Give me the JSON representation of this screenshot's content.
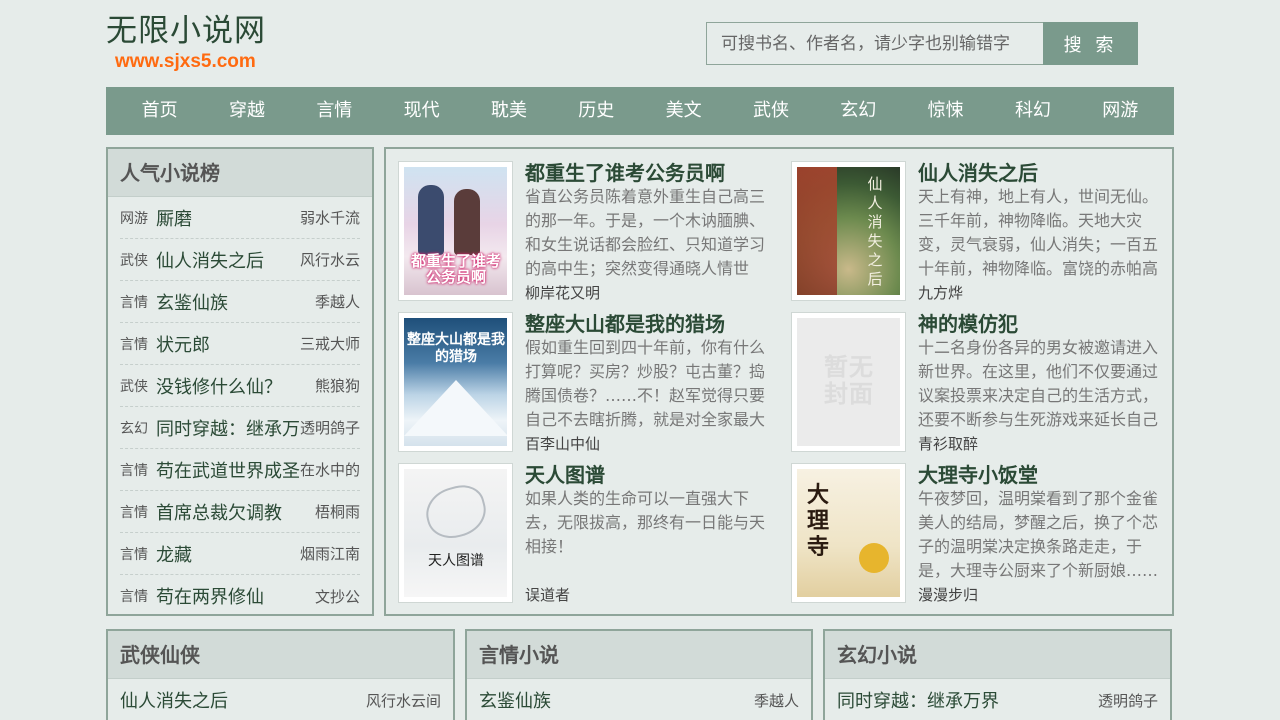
{
  "site": {
    "title": "无限小说网",
    "url": "www.sjxs5.com"
  },
  "search": {
    "placeholder": "可搜书名、作者名，请少字也别输错字",
    "button": "搜 索"
  },
  "nav": [
    "首页",
    "穿越",
    "言情",
    "现代",
    "耽美",
    "历史",
    "美文",
    "武侠",
    "玄幻",
    "惊悚",
    "科幻",
    "网游"
  ],
  "ranking": {
    "title": "人气小说榜",
    "items": [
      {
        "cat": "网游",
        "title": "厮磨",
        "author": "弱水千流"
      },
      {
        "cat": "武侠",
        "title": "仙人消失之后",
        "author": "风行水云"
      },
      {
        "cat": "言情",
        "title": "玄鉴仙族",
        "author": "季越人"
      },
      {
        "cat": "言情",
        "title": "状元郎",
        "author": "三戒大师"
      },
      {
        "cat": "武侠",
        "title": "没钱修什么仙？",
        "author": "熊狼狗"
      },
      {
        "cat": "玄幻",
        "title": "同时穿越：继承万",
        "author": "透明鸽子"
      },
      {
        "cat": "言情",
        "title": "苟在武道世界成圣",
        "author": "在水中的"
      },
      {
        "cat": "言情",
        "title": "首席总裁欠调教",
        "author": "梧桐雨"
      },
      {
        "cat": "言情",
        "title": "龙藏",
        "author": "烟雨江南"
      },
      {
        "cat": "言情",
        "title": "苟在两界修仙",
        "author": "文抄公"
      }
    ]
  },
  "featured": [
    {
      "title": "都重生了谁考公务员啊",
      "desc": "省直公务员陈着意外重生自己高三的那一年。于是，一个木讷腼腆、和女生说话都会脸红、只知道学习的高中生；突然变得通晓人情世",
      "author": "柳岸花又明",
      "cover_text": "都重生了谁考公务员啊"
    },
    {
      "title": "仙人消失之后",
      "desc": "天上有神，地上有人，世间无仙。三千年前，神物降临。天地大灾变，灵气衰弱，仙人消失；一百五十年前，神物降临。富饶的赤帕高",
      "author": "九方烨",
      "cover_text": "仙人消失之后"
    },
    {
      "title": "整座大山都是我的猎场",
      "desc": "假如重生回到四十年前，你有什么打算呢？买房？炒股？屯古董？捣腾国债卷？……不！赵军觉得只要自己不去瞎折腾，就是对全家最大",
      "author": "百李山中仙",
      "cover_text": "整座大山都是我的猎场"
    },
    {
      "title": "神的模仿犯",
      "desc": "十二名身份各异的男女被邀请进入新世界。在这里，他们不仅要通过议案投票来决定自己的生活方式，还要不断参与生死游戏来延长自己",
      "author": "青衫取醉",
      "cover_text": "暂无封面"
    },
    {
      "title": "天人图谱",
      "desc": "如果人类的生命可以一直强大下去，无限拔高，那终有一日能与天相接！",
      "author": "误道者",
      "cover_text": "天人图谱"
    },
    {
      "title": "大理寺小饭堂",
      "desc": "午夜梦回，温明棠看到了那个金雀美人的结局，梦醒之后，换了个芯子的温明棠决定换条路走走，于是，大理寺公厨来了个新厨娘……",
      "author": "漫漫步归",
      "cover_text": "大理寺"
    }
  ],
  "categories": [
    {
      "title": "武侠仙侠",
      "items": [
        {
          "title": "仙人消失之后",
          "author": "风行水云间"
        }
      ]
    },
    {
      "title": "言情小说",
      "items": [
        {
          "title": "玄鉴仙族",
          "author": "季越人"
        }
      ]
    },
    {
      "title": "玄幻小说",
      "items": [
        {
          "title": "同时穿越：继承万界",
          "author": "透明鸽子"
        }
      ]
    }
  ]
}
